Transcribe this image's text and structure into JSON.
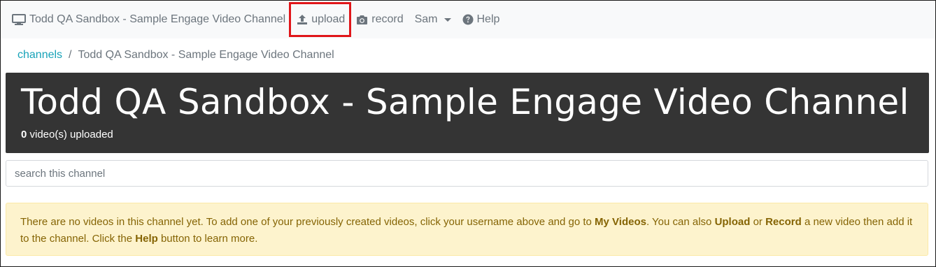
{
  "navbar": {
    "brand_label": "Todd QA Sandbox - Sample Engage Video Channel",
    "upload_label": "upload",
    "record_label": "record",
    "user_label": "Sam",
    "help_label": "Help"
  },
  "breadcrumb": {
    "root_label": "channels",
    "separator": "/",
    "current_label": "Todd QA Sandbox - Sample Engage Video Channel"
  },
  "channel": {
    "title": "Todd QA Sandbox - Sample Engage Video Channel",
    "video_count": "0",
    "video_count_suffix": " video(s) uploaded"
  },
  "search": {
    "placeholder": "search this channel"
  },
  "alert": {
    "part1": "There are no videos in this channel yet. To add one of your previously created videos, click your username above and go to ",
    "my_videos": "My Videos",
    "part2": ". You can also ",
    "upload": "Upload",
    "part3": " or ",
    "record": "Record",
    "part4": " a new video then add it to the channel. Click the ",
    "help": "Help",
    "part5": " button to learn more."
  },
  "colors": {
    "accent_link": "#17a2b8",
    "highlight_box": "#e0161a",
    "jumbotron_bg": "#343434",
    "alert_bg": "#fdf3cd",
    "alert_text": "#856404"
  }
}
